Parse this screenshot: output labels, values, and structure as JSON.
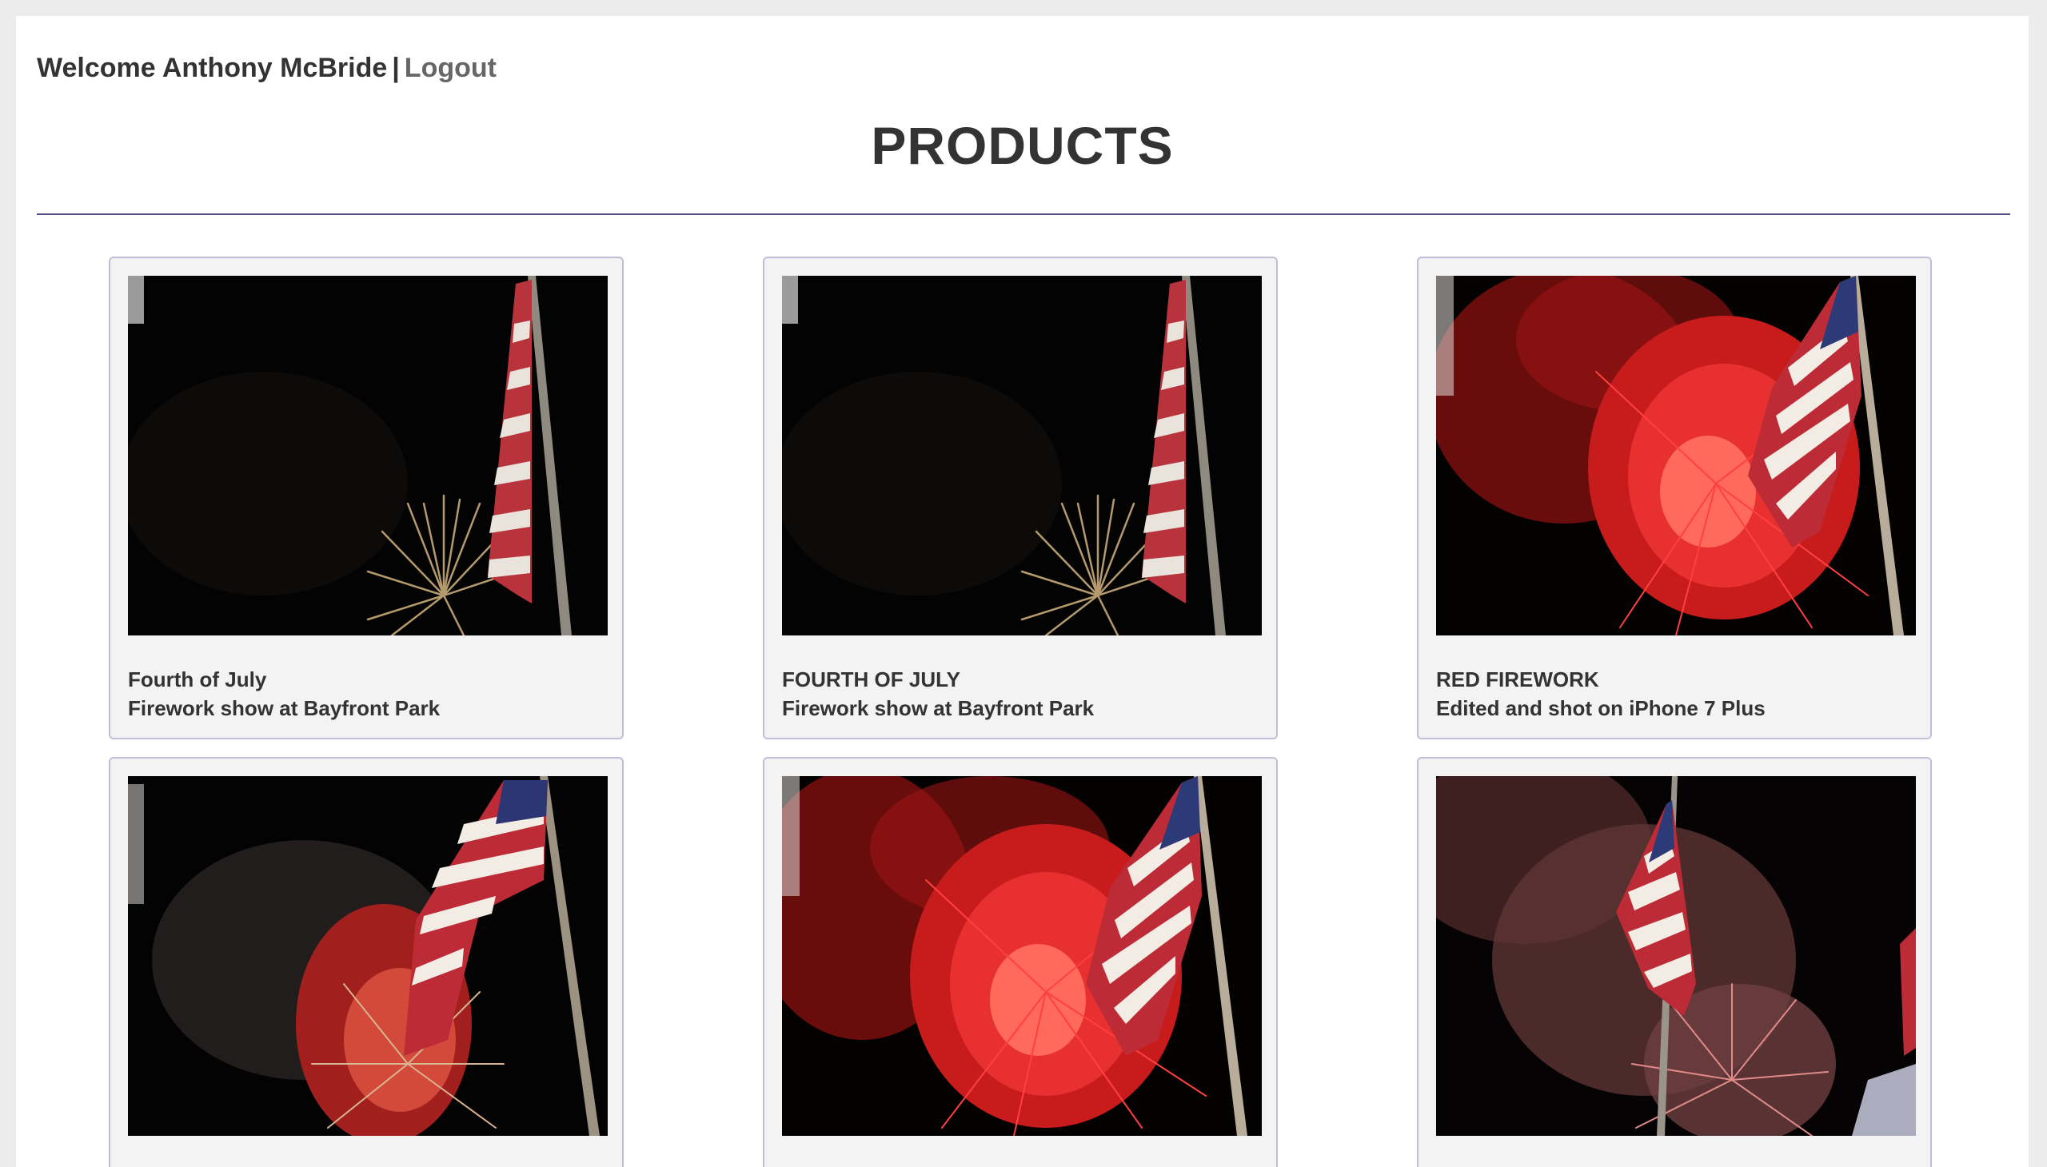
{
  "header": {
    "welcome_text": "Welcome Anthony McBride",
    "separator": "|",
    "logout_label": "Logout"
  },
  "page": {
    "title": "PRODUCTS"
  },
  "colors": {
    "rule": "#554c86",
    "card_border": "#c1bed8",
    "card_background": "#f3f3f3"
  },
  "products": [
    {
      "title": "Fourth of July",
      "description": "Firework show at Bayfront Park",
      "image_icon": "flag-golden-firework-photo"
    },
    {
      "title": "FOURTH OF JULY",
      "description": "Firework show at Bayfront Park",
      "image_icon": "flag-golden-firework-photo"
    },
    {
      "title": "RED FIREWORK",
      "description": "Edited and shot on iPhone 7 Plus",
      "image_icon": "flag-red-firework-photo"
    },
    {
      "title": "",
      "description": "",
      "image_icon": "flag-red-smoke-firework-photo"
    },
    {
      "title": "",
      "description": "",
      "image_icon": "flag-red-firework-photo"
    },
    {
      "title": "",
      "description": "",
      "image_icon": "flag-pink-firework-photo"
    }
  ]
}
